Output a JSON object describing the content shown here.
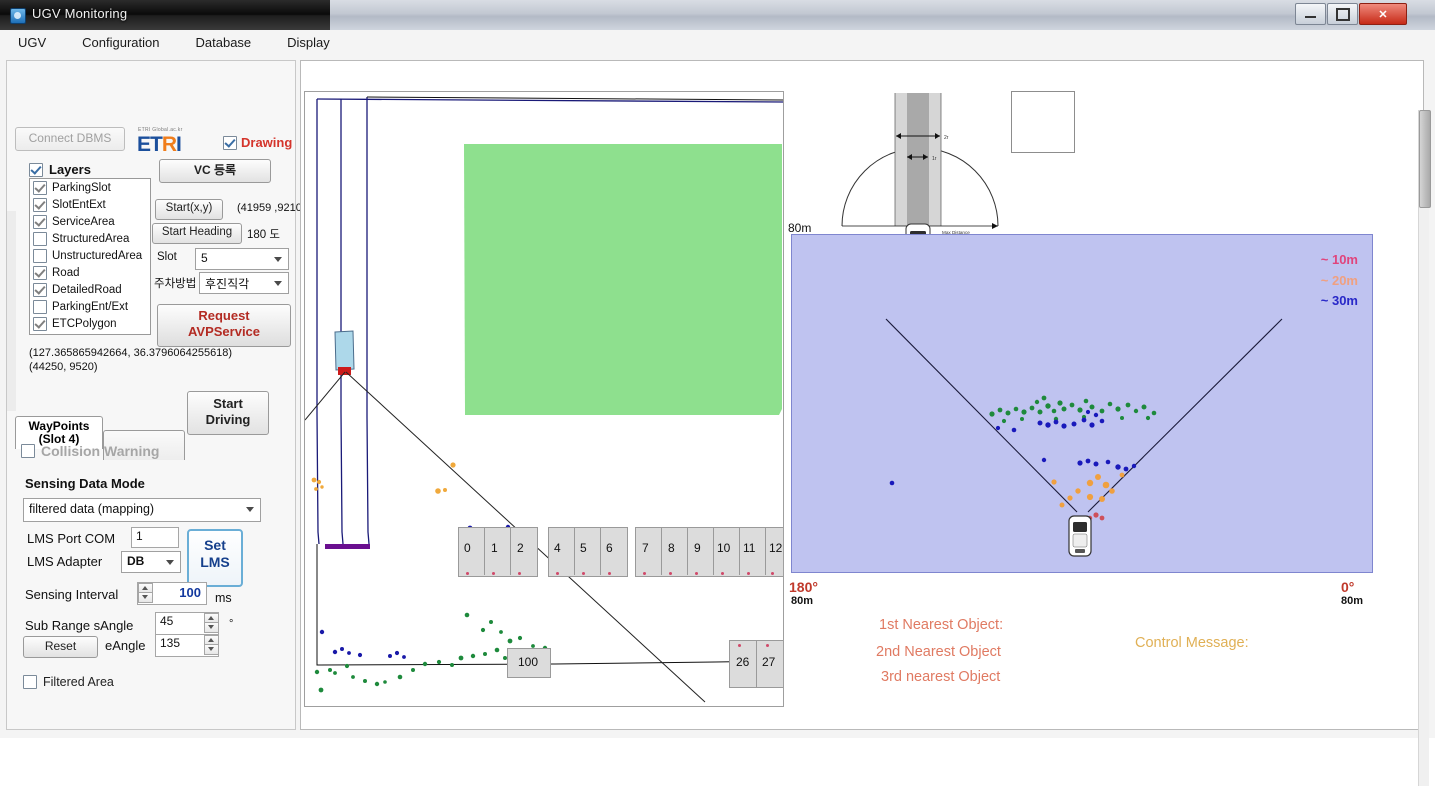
{
  "window": {
    "title": "UGV Monitoring",
    "minimize_label": "Minimize",
    "maximize_label": "Maximize",
    "close_label": "✕"
  },
  "menu": {
    "items": [
      "UGV",
      "Configuration",
      "Database",
      "Display"
    ]
  },
  "left_panel": {
    "connect_dbms": "Connect DBMS",
    "logo": {
      "tagline": "ETRI Global.ac.kr",
      "part1": "ET",
      "part2": "R",
      "part3": "I"
    },
    "drawing": {
      "label": "Drawing",
      "checked": true
    },
    "layers_header": {
      "label": "Layers",
      "checked": true
    },
    "layers": [
      {
        "label": "ParkingSlot",
        "checked": true
      },
      {
        "label": "SlotEntExt",
        "checked": true
      },
      {
        "label": "ServiceArea",
        "checked": true
      },
      {
        "label": "StructuredArea",
        "checked": false
      },
      {
        "label": "UnstructuredArea",
        "checked": false
      },
      {
        "label": "Road",
        "checked": true
      },
      {
        "label": "DetailedRoad",
        "checked": true
      },
      {
        "label": "ParkingEnt/Ext",
        "checked": false
      },
      {
        "label": "ETCPolygon",
        "checked": true
      }
    ],
    "vc_register": "VC 등록",
    "start_xy_button": "Start(x,y)",
    "start_xy_value": "(41959 ,9210",
    "start_heading_button": "Start Heading",
    "start_heading_value": "180 도",
    "slot_label": "Slot",
    "slot_value": "5",
    "park_method_label": "주차방법",
    "park_method_value": "후진직각",
    "request_avp_line1": "Request",
    "request_avp_line2": "AVPService",
    "coord_wgs": "(127.365865942664, 36.3796064255618)",
    "coord_local": "(44250, 9520)",
    "start_driving_line1": "Start",
    "start_driving_line2": "Driving",
    "tab_waypoints_line1": "WayPoints",
    "tab_waypoints_line2": "(Slot 4)",
    "tab_other": "",
    "collision_warning": {
      "label": "Collision Warning",
      "checked": false
    },
    "sensing_data_mode_title": "Sensing Data Mode",
    "sensing_data_mode_value": "filtered data (mapping)",
    "lms_port_label": "LMS Port COM",
    "lms_port_value": "1",
    "lms_adapter_label": "LMS Adapter",
    "lms_adapter_value": "DB",
    "set_lms_line1": "Set",
    "set_lms_line2": "LMS",
    "sensing_interval_label": "Sensing Interval",
    "sensing_interval_value": "100",
    "sensing_interval_unit": "ms",
    "sub_range_label": "Sub Range  sAngle",
    "s_angle_value": "45",
    "degree_sign": "°",
    "reset_button": "Reset",
    "e_angle_label": "eAngle",
    "e_angle_value": "135",
    "filtered_area": {
      "label": "Filtered Area",
      "checked": false
    }
  },
  "map": {
    "slot_labels_row_top": [
      "0",
      "1",
      "2",
      "4",
      "5",
      "6",
      "7",
      "8",
      "9",
      "10",
      "11",
      "12"
    ],
    "slot_label_100": "100",
    "slot_labels_row_right": [
      "26",
      "27"
    ]
  },
  "vehicle_diagram": {
    "max_distance_label": "Max Distance",
    "dim_label_1": "2r",
    "dim_label_2": "1r",
    "scale_80m": "80m"
  },
  "radar": {
    "legend": [
      {
        "label": "~ 10m",
        "color": "#e0447c"
      },
      {
        "label": "~ 20m",
        "color": "#f0a080"
      },
      {
        "label": "~ 30m",
        "color": "#2828c8"
      }
    ],
    "left_angle": "180°",
    "left_range": "80m",
    "right_angle": "0°",
    "right_range": "80m",
    "nearest_1": "1st Nearest Object:",
    "nearest_2": "2nd Nearest Object",
    "nearest_3": "3rd nearest Object",
    "control_message": "Control Message:"
  },
  "colors": {
    "accent_red": "#d4342b",
    "radar_bg": "#bfc3f0",
    "service_area_green": "#8ee08e",
    "road_navy": "#1a1a78",
    "highlight_slot": "#add8ea"
  }
}
